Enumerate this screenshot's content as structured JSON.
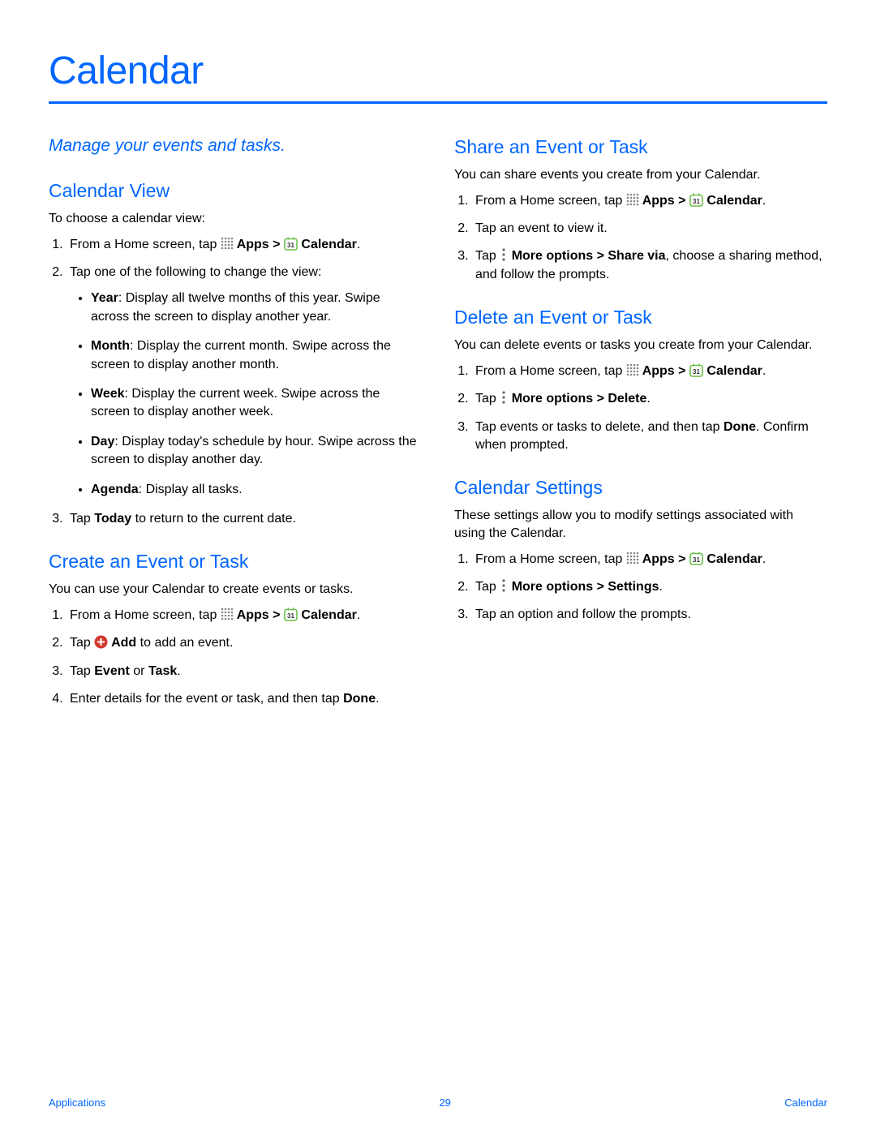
{
  "title": "Calendar",
  "intro": "Manage your events and tasks.",
  "left": {
    "sec1": {
      "heading": "Calendar View",
      "intro": "To choose a calendar view:",
      "step1a": "From a Home screen, tap ",
      "step1b": " Apps > ",
      "step1c": " Calendar",
      "step1d": ".",
      "step2": "Tap one of the following to change the view:",
      "b1a": "Year",
      "b1b": ": Display all twelve months of this year. Swipe across the screen to display another year.",
      "b2a": "Month",
      "b2b": ": Display the current month. Swipe across the screen to display another month.",
      "b3a": "Week",
      "b3b": ": Display the current week. Swipe across the screen to display another week.",
      "b4a": "Day",
      "b4b": ": Display today's schedule by hour. Swipe across the screen to display another day.",
      "b5a": "Agenda",
      "b5b": ": Display all tasks.",
      "step3a": "Tap ",
      "step3b": "Today",
      "step3c": " to return to the current date."
    },
    "sec2": {
      "heading": "Create an Event or Task",
      "intro": "You can use your Calendar to create events or tasks.",
      "step1a": "From a Home screen, tap ",
      "step1b": " Apps > ",
      "step1c": " Calendar",
      "step1d": ".",
      "step2a": "Tap ",
      "step2b": " Add",
      "step2c": " to add an event.",
      "step3a": "Tap ",
      "step3b": "Event",
      "step3c": " or ",
      "step3d": "Task",
      "step3e": ".",
      "step4a": "Enter details for the event or task, and then tap ",
      "step4b": "Done",
      "step4c": "."
    }
  },
  "right": {
    "sec1": {
      "heading": "Share an Event or Task",
      "intro": "You can share events you create from your Calendar.",
      "step1a": "From a Home screen, tap ",
      "step1b": " Apps > ",
      "step1c": " Calendar",
      "step1d": ".",
      "step2": "Tap an event to view it.",
      "step3a": "Tap ",
      "step3b": " More options > Share via",
      "step3c": ", choose a sharing method, and follow the prompts."
    },
    "sec2": {
      "heading": "Delete an Event or Task",
      "intro": "You can delete events or tasks you create from your Calendar.",
      "step1a": "From a Home screen, tap ",
      "step1b": " Apps > ",
      "step1c": " Calendar",
      "step1d": ".",
      "step2a": "Tap ",
      "step2b": " More options > Delete",
      "step2c": ".",
      "step3a": "Tap events or tasks to delete, and then tap ",
      "step3b": "Done",
      "step3c": ". Confirm when prompted."
    },
    "sec3": {
      "heading": "Calendar Settings",
      "intro": "These settings allow you to modify settings associated with using the Calendar.",
      "step1a": "From a Home screen, tap ",
      "step1b": " Apps > ",
      "step1c": " Calendar",
      "step1d": ".",
      "step2a": "Tap ",
      "step2b": " More options > Settings",
      "step2c": ".",
      "step3": "Tap an option and follow the prompts."
    }
  },
  "footer": {
    "left": "Applications",
    "center": "29",
    "right": "Calendar"
  }
}
